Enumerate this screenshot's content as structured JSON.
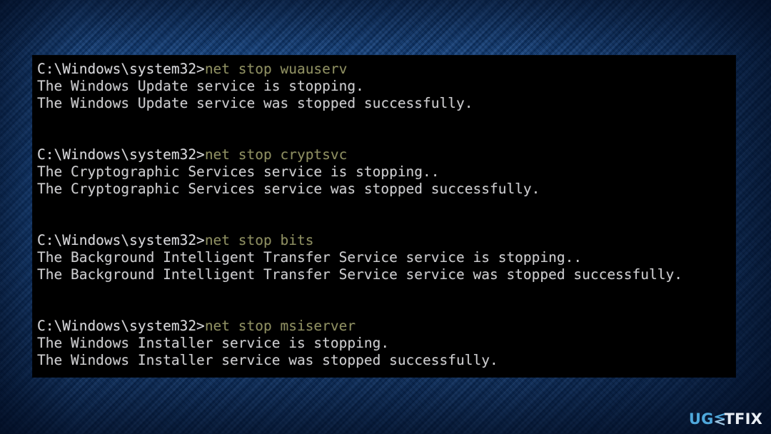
{
  "window": {
    "kind": "windows-command-prompt",
    "background_color": "#000000",
    "prompt_text_color": "#d8d8db",
    "command_text_color": "#8e8f62",
    "output_text_color": "#ccccce"
  },
  "background": {
    "style": "blue-carbon-fiber-weave",
    "base_color": "#14427f",
    "edge_color": "#0a1f40"
  },
  "console": {
    "prompt": "C:\\Windows\\system32>",
    "blocks": [
      {
        "command": "net stop wuauserv",
        "output": [
          "The Windows Update service is stopping.",
          "The Windows Update service was stopped successfully."
        ]
      },
      {
        "command": "net stop cryptsvc",
        "output": [
          "The Cryptographic Services service is stopping..",
          "The Cryptographic Services service was stopped successfully."
        ]
      },
      {
        "command": "net stop bits",
        "output": [
          "The Background Intelligent Transfer Service service is stopping..",
          "The Background Intelligent Transfer Service service was stopped successfully."
        ]
      },
      {
        "command": "net stop msiserver",
        "output": [
          "The Windows Installer service is stopping.",
          "The Windows Installer service was stopped successfully."
        ]
      }
    ]
  },
  "watermark": {
    "part_one": "UG",
    "glyph": "stylized-e",
    "part_two": "TFIX",
    "color_one": "#4fa8dc",
    "color_two": "#e9eef4"
  }
}
